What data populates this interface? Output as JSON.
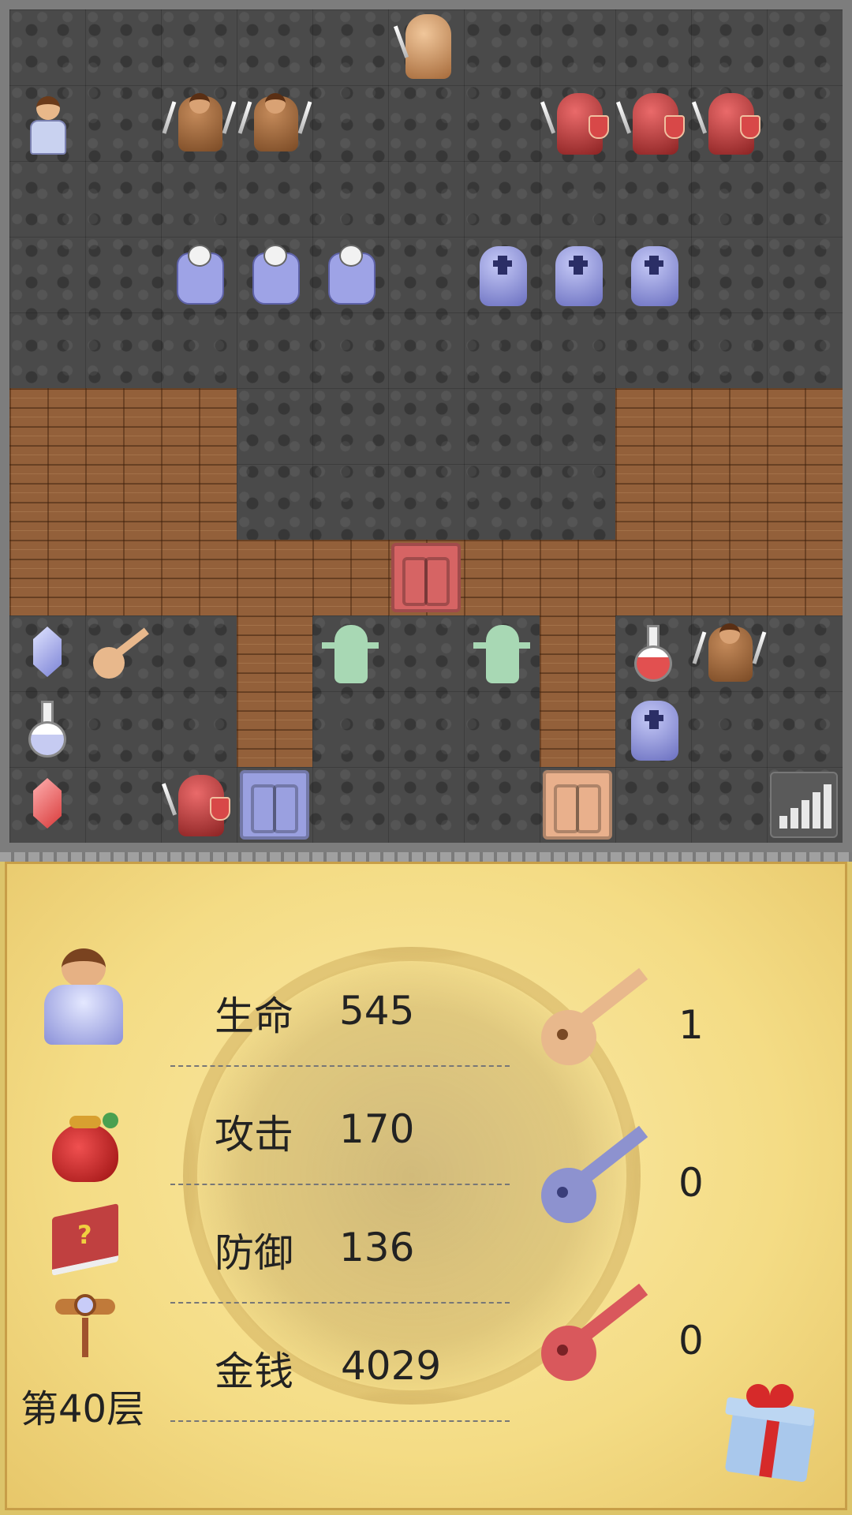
{
  "map": {
    "tiles": [
      {
        "name": "tan-knight-enemy",
        "row": 0,
        "col": 5
      },
      {
        "name": "hero-player",
        "row": 1,
        "col": 0
      },
      {
        "name": "brown-warrior-enemy",
        "row": 1,
        "col": 2
      },
      {
        "name": "brown-warrior-enemy",
        "row": 1,
        "col": 3
      },
      {
        "name": "red-knight-enemy",
        "row": 1,
        "col": 7
      },
      {
        "name": "red-knight-enemy",
        "row": 1,
        "col": 8
      },
      {
        "name": "red-knight-enemy",
        "row": 1,
        "col": 9
      },
      {
        "name": "skeleton-enemy",
        "row": 3,
        "col": 2
      },
      {
        "name": "skeleton-enemy",
        "row": 3,
        "col": 3
      },
      {
        "name": "skeleton-enemy",
        "row": 3,
        "col": 4
      },
      {
        "name": "blue-knight-enemy",
        "row": 3,
        "col": 6
      },
      {
        "name": "blue-knight-enemy",
        "row": 3,
        "col": 7
      },
      {
        "name": "blue-knight-enemy",
        "row": 3,
        "col": 8
      },
      {
        "name": "red-door",
        "row": 7,
        "col": 5
      },
      {
        "name": "blue-gem-item",
        "row": 8,
        "col": 0
      },
      {
        "name": "yellow-key-item",
        "row": 8,
        "col": 1
      },
      {
        "name": "zombie-enemy",
        "row": 8,
        "col": 4
      },
      {
        "name": "zombie-enemy",
        "row": 8,
        "col": 6
      },
      {
        "name": "red-potion-item",
        "row": 8,
        "col": 8
      },
      {
        "name": "brown-warrior-enemy",
        "row": 8,
        "col": 9
      },
      {
        "name": "blue-potion-item",
        "row": 9,
        "col": 0
      },
      {
        "name": "blue-knight-enemy",
        "row": 9,
        "col": 8
      },
      {
        "name": "red-gem-item",
        "row": 10,
        "col": 0
      },
      {
        "name": "red-knight-enemy",
        "row": 10,
        "col": 2
      },
      {
        "name": "blue-door",
        "row": 10,
        "col": 3
      },
      {
        "name": "yellow-door",
        "row": 10,
        "col": 7
      },
      {
        "name": "signal-icon",
        "row": 10,
        "col": 10
      }
    ]
  },
  "status": {
    "stats": [
      {
        "label": "生命",
        "value": "545"
      },
      {
        "label": "攻击",
        "value": "170"
      },
      {
        "label": "防御",
        "value": "136"
      },
      {
        "label": "金钱",
        "value": "4029"
      }
    ],
    "keys": [
      {
        "color": "yellow",
        "count": "1"
      },
      {
        "color": "blue",
        "count": "0"
      },
      {
        "color": "red",
        "count": "0"
      }
    ],
    "floor": "第40层",
    "icons": [
      "hero-portrait-icon",
      "lucky-bag-icon",
      "monster-book-icon",
      "fly-wand-icon",
      "gift-box-icon"
    ]
  },
  "colors": {
    "yellow_key": "#e8b88c",
    "blue_key": "#8d92cf",
    "red_key": "#d9585c",
    "red_door": "#d66464",
    "blue_door": "#9aa0e0",
    "yellow_door": "#e9b08c"
  }
}
